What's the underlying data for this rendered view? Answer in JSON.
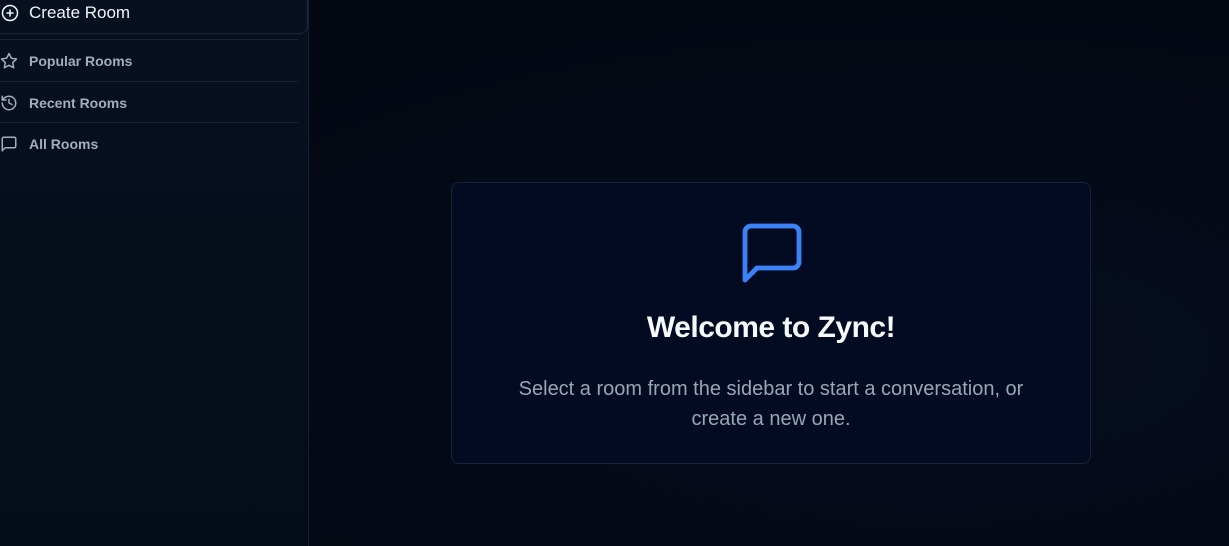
{
  "sidebar": {
    "create_room": {
      "label": "Create Room",
      "icon": "plus-circle-icon"
    },
    "items": [
      {
        "label": "Popular Rooms",
        "icon": "star-icon"
      },
      {
        "label": "Recent Rooms",
        "icon": "history-icon"
      },
      {
        "label": "All Rooms",
        "icon": "chat-bubble-icon"
      }
    ]
  },
  "main": {
    "welcome": {
      "icon": "message-square-icon",
      "title": "Welcome to Zync!",
      "text": "Select a room from the sidebar to start a conversation, or create a new one."
    }
  },
  "colors": {
    "accent": "#3b82f6",
    "background": "#040a16",
    "card": "#020b22"
  }
}
